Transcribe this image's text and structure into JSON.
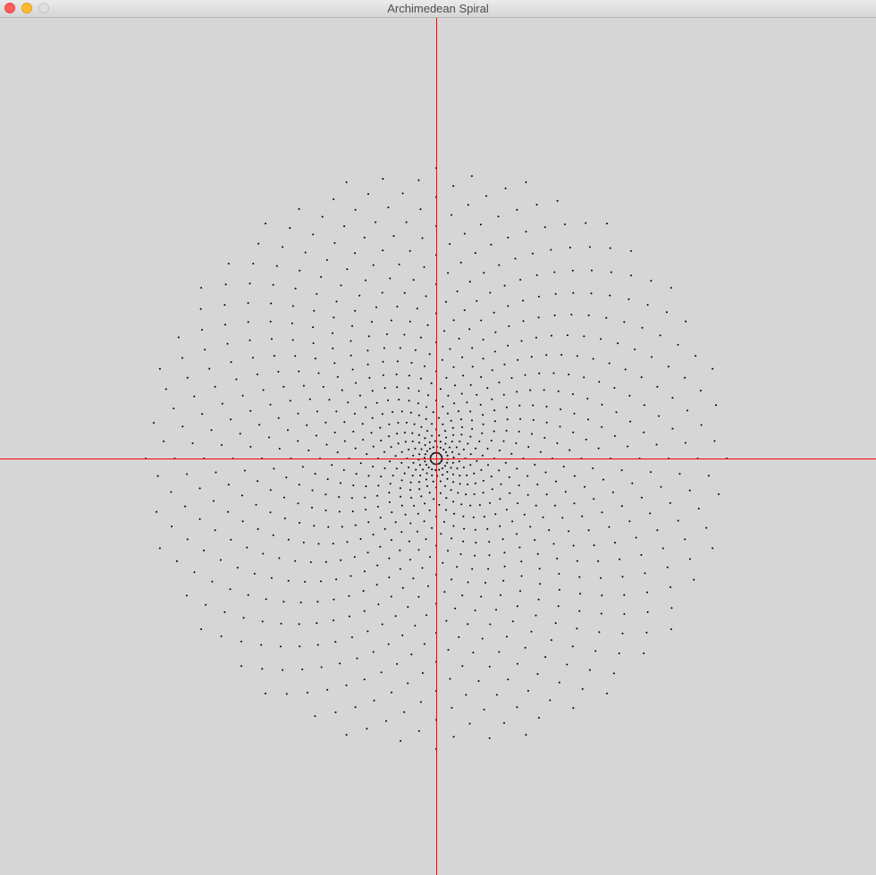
{
  "window": {
    "title": "Archimedean Spiral",
    "controls": {
      "close_color": "#fd5f57",
      "minimize_color": "#febc2e",
      "zoom_color": "#dedede"
    }
  },
  "colors": {
    "background": "#d6d6d6",
    "axis": "#ff0000",
    "point": "#000000"
  },
  "spiral": {
    "type": "scatter",
    "arms": 20,
    "points_per_arm": 50,
    "turns_per_arm": 1,
    "axes": "center-crosshair"
  }
}
